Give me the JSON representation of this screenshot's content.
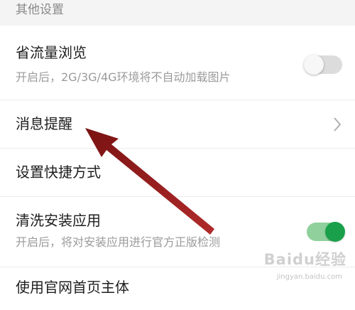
{
  "section_header": "其他设置",
  "rows": [
    {
      "title": "省流量浏览",
      "subtitle": "开启后，2G/3G/4G环境将不自动加载图片",
      "control": "toggle",
      "toggle_on": false
    },
    {
      "title": "消息提醒",
      "control": "chevron"
    },
    {
      "title": "设置快捷方式"
    },
    {
      "title": "清洗安装应用",
      "subtitle": "开启后，将对安装应用进行官方正版检测",
      "control": "toggle",
      "toggle_on": true
    },
    {
      "title": "使用官网首页主体"
    }
  ],
  "colors": {
    "toggle_on_track": "#8fd09c",
    "toggle_on_knob": "#1aa04a",
    "arrow": "#8b1a1a"
  },
  "watermark": {
    "text": "Baidu经验",
    "url": "jingyan.baidu.com"
  }
}
